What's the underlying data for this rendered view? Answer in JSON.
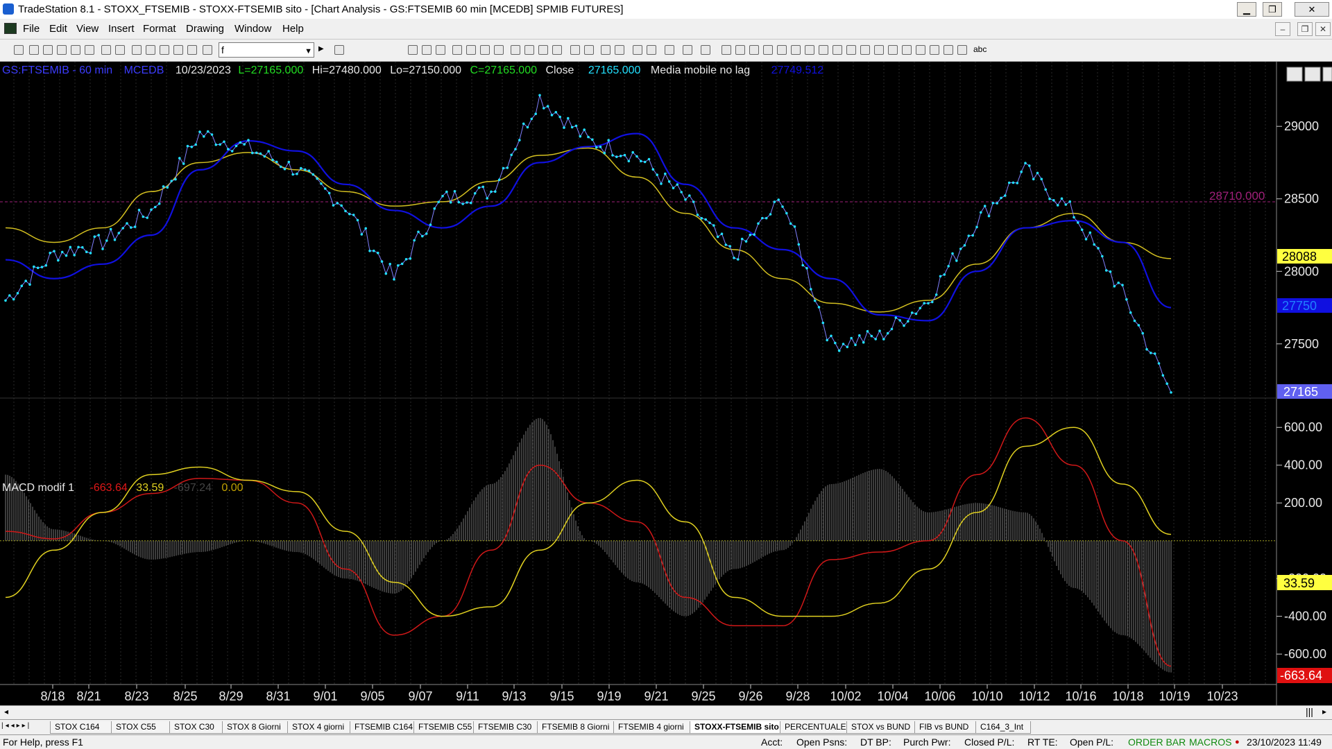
{
  "window": {
    "title": "TradeStation 8.1 - STOXX_FTSEMIB - STOXX-FTSEMIB sito - [Chart Analysis - GS:FTSEMIB  60 min  [MCEDB] SPMIB FUTURES]",
    "minimize": "▁",
    "restore": "❐",
    "close": "✕"
  },
  "menu": {
    "items": [
      "File",
      "Edit",
      "View",
      "Insert",
      "Format",
      "Drawing",
      "Window",
      "Help"
    ],
    "mdi_minimize": "–",
    "mdi_restore": "❐",
    "mdi_close": "✕"
  },
  "toolbar": {
    "symbol_value": "f",
    "dropdown_arrow": "▼",
    "go_arrow": "▶",
    "abc_label": "abc"
  },
  "chart": {
    "header": {
      "symbol": "GS:FTSEMIB - 60 min",
      "session": "MCEDB",
      "date": "10/23/2023",
      "low_close_label": "L=27165.000",
      "high": "Hi=27480.000",
      "low": "Lo=27150.000",
      "close_eq": "C=27165.000",
      "close_word": "Close",
      "close_value": "27165.000",
      "study_name": "Media mobile no lag",
      "study_value": "27749.512"
    },
    "hline_label": "28710.000",
    "price_axis": {
      "ticks": [
        "29000",
        "28500",
        "28000",
        "27500"
      ],
      "tags": {
        "yellow": "28088",
        "blue": "27750",
        "last": "27165"
      }
    },
    "macd_header": {
      "name": "MACD modif 1",
      "v1": "-663.64",
      "v2": "33.59",
      "v3": "-697.24",
      "v4": "0.00"
    },
    "macd_axis": {
      "ticks": [
        "600.00",
        "400.00",
        "200.00",
        "-200.00",
        "-400.00",
        "-600.00"
      ],
      "tags": {
        "signal": "33.59",
        "macd": "-663.64"
      }
    },
    "date_labels": [
      "8/18",
      "8/21",
      "8/23",
      "8/25",
      "8/29",
      "8/31",
      "9/01",
      "9/05",
      "9/07",
      "9/11",
      "9/13",
      "9/15",
      "9/19",
      "9/21",
      "9/25",
      "9/26",
      "9/28",
      "10/02",
      "10/04",
      "10/06",
      "10/10",
      "10/12",
      "10/16",
      "10/18",
      "10/19",
      "10/23"
    ],
    "colors": {
      "price": "#22e0ff",
      "ma_blue": "#1010e0",
      "ma_yellow": "#d4c020",
      "macd": "#d01818",
      "signal": "#e0d020",
      "hist": "#7a7a7a",
      "hline": "#a0207a"
    }
  },
  "chart_data": [
    {
      "type": "line",
      "title": "GS:FTSEMIB - 60 min",
      "ylim": [
        27150,
        29350
      ],
      "x": [
        "8/18",
        "8/21",
        "8/23",
        "8/25",
        "8/29",
        "8/31",
        "9/01",
        "9/05",
        "9/07",
        "9/11",
        "9/13",
        "9/15",
        "9/19",
        "9/21",
        "9/25",
        "9/26",
        "9/28",
        "10/02",
        "10/04",
        "10/06",
        "10/10",
        "10/12",
        "10/16",
        "10/18",
        "10/19"
      ],
      "series": [
        {
          "name": "Close",
          "values": [
            27800,
            28120,
            28200,
            28420,
            28950,
            28850,
            28700,
            28450,
            27950,
            28500,
            28550,
            29200,
            28900,
            28800,
            28500,
            28100,
            28500,
            27500,
            27550,
            27800,
            28350,
            28700,
            28400,
            27850,
            27165
          ]
        },
        {
          "name": "Media mobile no lag",
          "values": [
            28080,
            27950,
            28050,
            28250,
            28700,
            28900,
            28830,
            28600,
            28420,
            28300,
            28450,
            28750,
            28860,
            28950,
            28600,
            28300,
            28150,
            27950,
            27700,
            27660,
            28000,
            28300,
            28350,
            28200,
            27750
          ]
        },
        {
          "name": "",
          "values": [
            28300,
            28200,
            28300,
            28550,
            28750,
            28820,
            28700,
            28550,
            28450,
            28480,
            28620,
            28800,
            28850,
            28650,
            28400,
            28150,
            27950,
            27780,
            27720,
            27800,
            28050,
            28300,
            28400,
            28200,
            28088
          ]
        }
      ],
      "hlines": [
        28710
      ]
    },
    {
      "type": "line",
      "title": "MACD modif 1",
      "ylim": [
        -750,
        700
      ],
      "x": [
        "8/18",
        "8/21",
        "8/23",
        "8/25",
        "8/29",
        "8/31",
        "9/01",
        "9/05",
        "9/07",
        "9/11",
        "9/13",
        "9/15",
        "9/19",
        "9/21",
        "9/25",
        "9/26",
        "9/28",
        "10/02",
        "10/04",
        "10/06",
        "10/10",
        "10/12",
        "10/16",
        "10/18",
        "10/19"
      ],
      "series": [
        {
          "name": "",
          "values": [
            50,
            10,
            150,
            250,
            330,
            320,
            200,
            -150,
            -500,
            -400,
            -50,
            400,
            200,
            100,
            -300,
            -450,
            -450,
            -100,
            -60,
            0,
            350,
            650,
            400,
            0,
            -663.64
          ]
        },
        {
          "name": "",
          "values": [
            -300,
            -50,
            150,
            350,
            390,
            320,
            260,
            50,
            -220,
            -400,
            -350,
            -50,
            200,
            320,
            100,
            -300,
            -400,
            -400,
            -330,
            -150,
            150,
            500,
            600,
            300,
            33.59
          ]
        },
        {
          "name": "",
          "values": [
            350,
            60,
            0,
            -100,
            -60,
            0,
            -60,
            -200,
            -280,
            0,
            300,
            650,
            0,
            -220,
            -400,
            -150,
            -50,
            300,
            380,
            150,
            200,
            150,
            -250,
            -500,
            -697.24
          ]
        }
      ]
    }
  ]
}
